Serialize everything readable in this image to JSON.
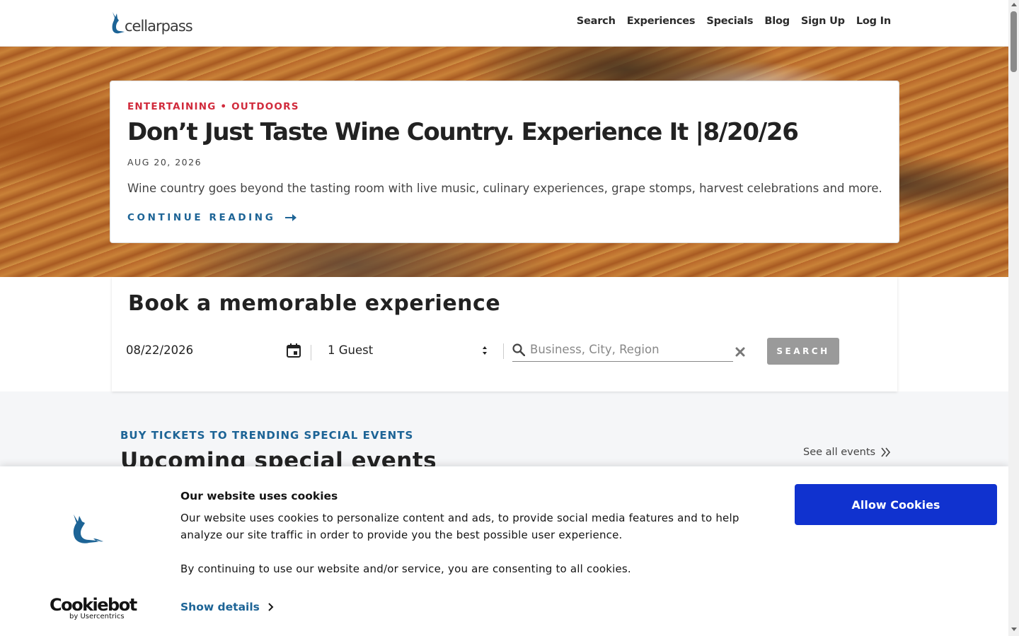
{
  "header": {
    "logo_text": "cellarpass",
    "nav": [
      "Search",
      "Experiences",
      "Specials",
      "Blog",
      "Sign Up",
      "Log In"
    ]
  },
  "hero": {
    "categories": "ENTERTAINING • OUTDOORS",
    "title": "Don’t Just Taste Wine Country. Experience It |8/20/26",
    "date": "AUG 20, 2026",
    "description": "Wine country goes beyond the tasting room with live music, culinary experiences, grape stomps, harvest celebrations and more.",
    "cta": "CONTINUE READING"
  },
  "booking": {
    "title": "Book a memorable experience",
    "date_value": "08/22/2026",
    "guests_value": "1 Guest",
    "search_placeholder": "Business, City, Region",
    "search_button": "SEARCH"
  },
  "events": {
    "kicker": "BUY TICKETS TO TRENDING SPECIAL EVENTS",
    "title": "Upcoming special events",
    "see_all": "See all events"
  },
  "cookie_banner": {
    "title": "Our website uses cookies",
    "body_1": "Our website uses cookies to personalize content and ads, to provide social media features and to help analyze our site traffic in order to provide you the best possible user experience.",
    "body_2": "By continuing to use our website and/or service, you are consenting to all cookies.",
    "show_details": "Show details",
    "allow_button": "Allow Cookies",
    "brand_name": "Cookiebot",
    "brand_sub": "by Usercentrics"
  },
  "colors": {
    "accent_red": "#d12b3c",
    "accent_blue": "#1d6496",
    "allow_button": "#1032cf",
    "search_button_disabled": "#9a9a9a"
  },
  "icons": [
    "cellarpass-fox-logo-icon",
    "arrow-right-icon",
    "calendar-icon",
    "select-arrows-icon",
    "search-icon",
    "clear-icon",
    "double-chevron-right-icon",
    "chevron-right-icon"
  ]
}
